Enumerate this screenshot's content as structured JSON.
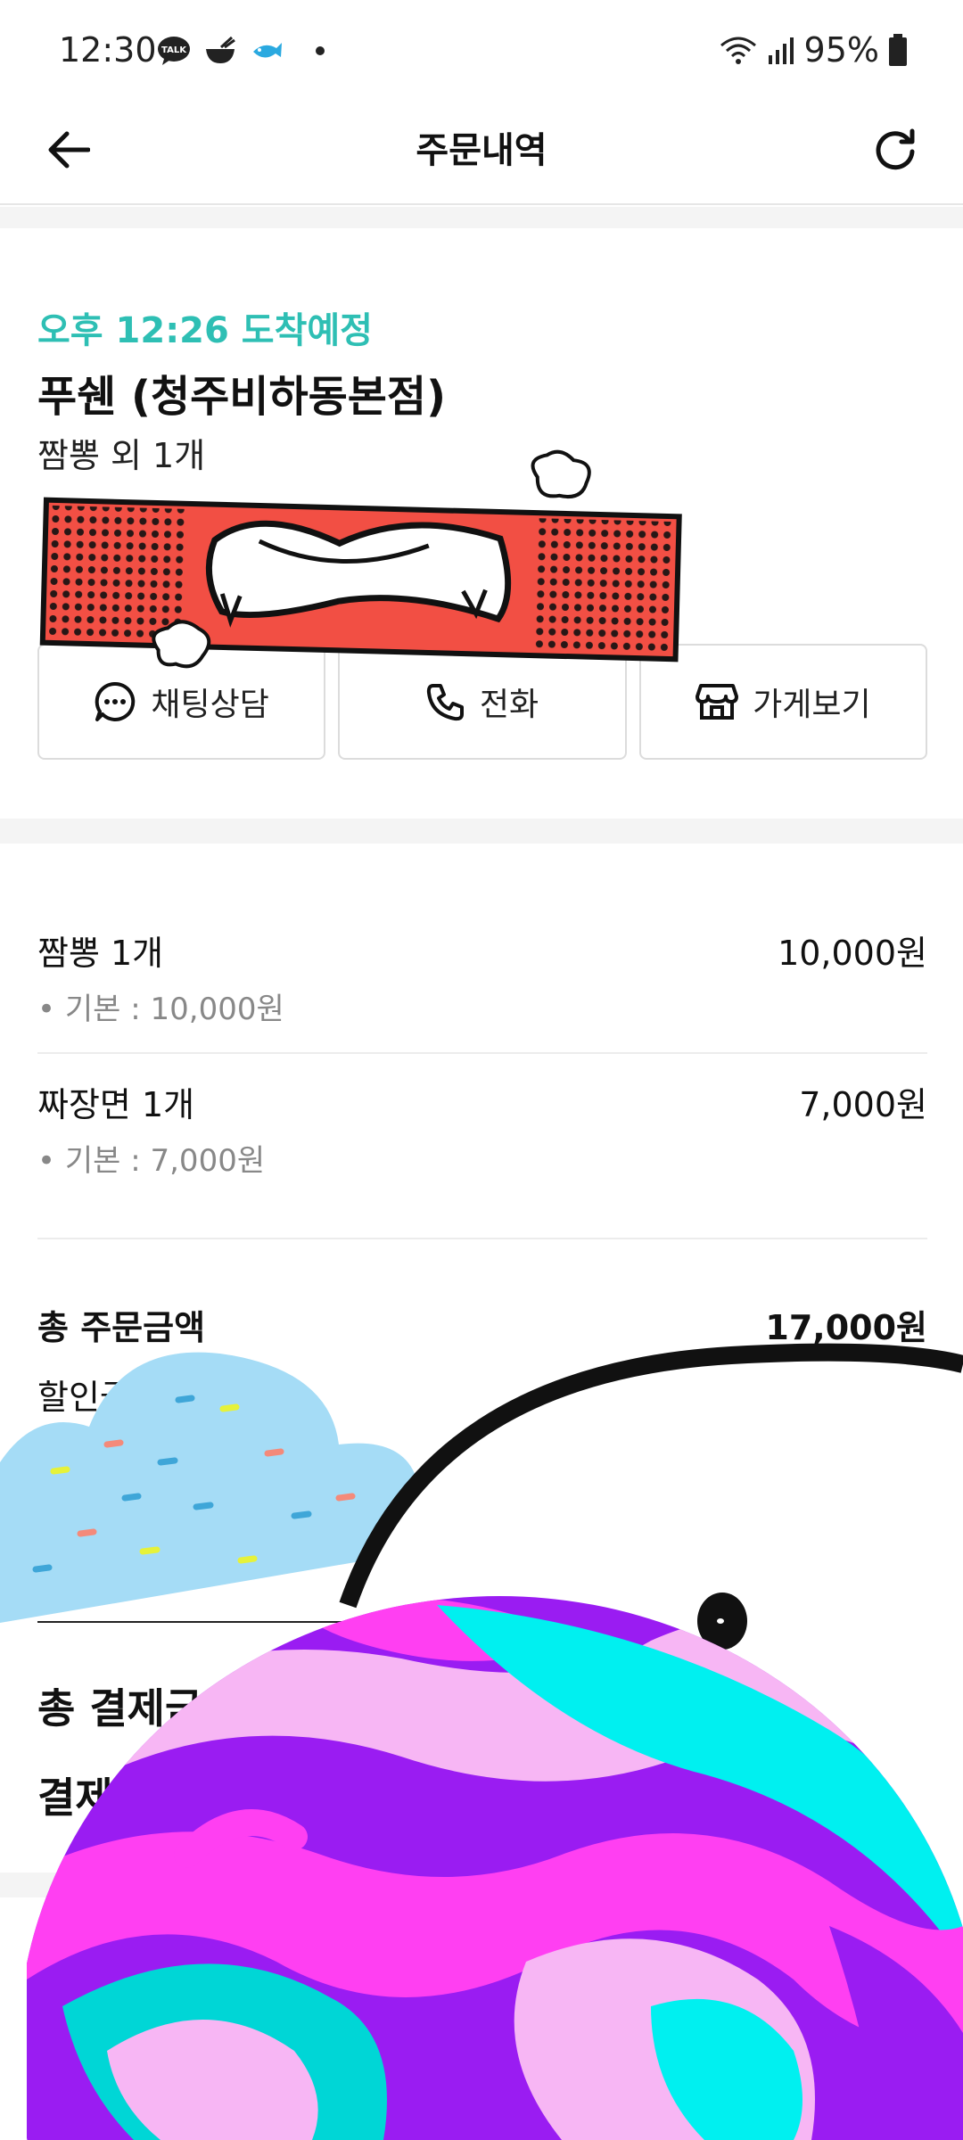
{
  "status_bar": {
    "time": "12:30",
    "battery": "95%"
  },
  "header": {
    "title": "주문내역"
  },
  "store": {
    "eta": "오후 12:26 도착예정",
    "name": "푸쉔 (청주비하동본점)",
    "summary": "짬뽕 외 1개"
  },
  "actions": [
    {
      "label": "채팅상담",
      "icon": "chat-icon"
    },
    {
      "label": "전화",
      "icon": "phone-icon"
    },
    {
      "label": "가게보기",
      "icon": "store-icon"
    }
  ],
  "items": [
    {
      "name": "짬뽕 1개",
      "price": "10,000원",
      "option": "• 기본 : 10,000원"
    },
    {
      "name": "짜장면 1개",
      "price": "7,000원",
      "option": "• 기본 : 7,000원"
    }
  ],
  "summary": {
    "total_order_label": "총 주문금액",
    "total_order_value": "17,000원",
    "discount_label": "할인금액"
  },
  "payment": {
    "total_label": "총 결제금액",
    "method_label": "결제방법"
  },
  "colors": {
    "accent": "#2ebfb4",
    "divider": "#ececec",
    "band": "#f4f4f4"
  }
}
